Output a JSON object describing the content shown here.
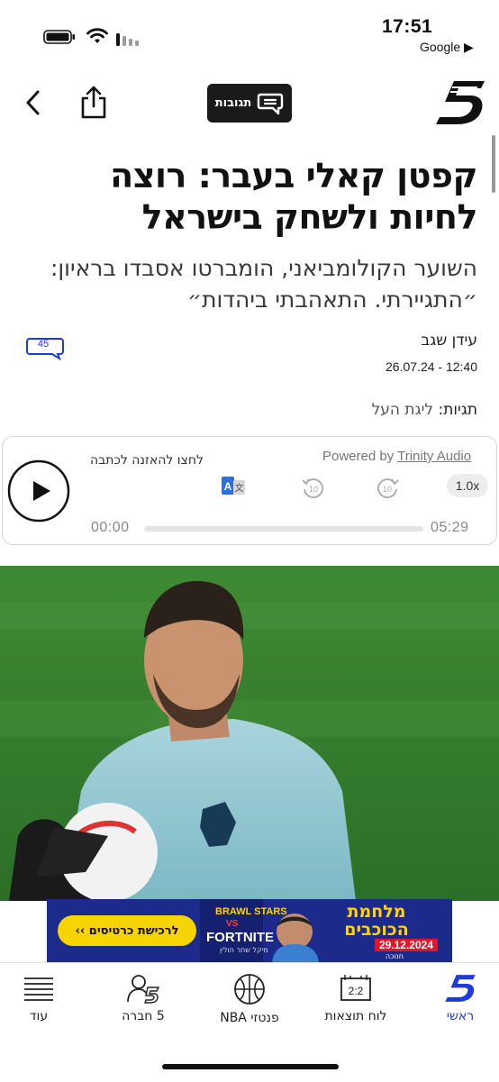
{
  "status_bar": {
    "time": "17:51",
    "carrier": "Google ▶"
  },
  "header": {
    "comments_button_label": "תגובות",
    "logo": "5"
  },
  "article": {
    "headline": "קפטן קאלי בעבר: רוצה לחיות ולשחק בישראל",
    "subheadline": "השוער הקולומביאני, הומברטו אסבדו בראיון: ״התגיירתי. התאהבתי ביהדות״",
    "author": "עידן שגב",
    "date": "26.07.24 - 12:40",
    "comment_count": "45",
    "tags_label": "תגיות:",
    "tags_value": "ליגת העל"
  },
  "audio_player": {
    "listen_label": "לחצו להאזנה לכתבה",
    "powered_by": "Powered by",
    "powered_link": "Trinity Audio",
    "speed": "1.0x",
    "rewind_label": "10",
    "forward_label": "10",
    "current_time": "00:00",
    "duration": "05:29",
    "progress": 0
  },
  "banner": {
    "cta": "לרכישת כרטיסים ››",
    "brand1": "BRAWL STARS",
    "vs": "VS",
    "brand2": "FORTNITE",
    "sub": "מיקל שחר חולין",
    "title": "מלחמת הכוכבים",
    "date": "29.12.2024",
    "tag": "חנוכה"
  },
  "bottom_nav": {
    "items": [
      {
        "label": "ראשי",
        "icon": "five-logo-icon",
        "active": true
      },
      {
        "label": "לוח תוצאות",
        "icon": "scoreboard-icon",
        "score": "2:2",
        "active": false
      },
      {
        "label": "פנטזי NBA",
        "icon": "basketball-icon",
        "active": false
      },
      {
        "label": "5 חברה",
        "icon": "community-icon",
        "active": false
      },
      {
        "label": "עוד",
        "icon": "menu-icon",
        "active": false
      }
    ]
  },
  "colors": {
    "accent": "#1d3bd8",
    "text": "#111111",
    "banner_bg": "#1c2a8c",
    "banner_yellow": "#f5d400"
  }
}
